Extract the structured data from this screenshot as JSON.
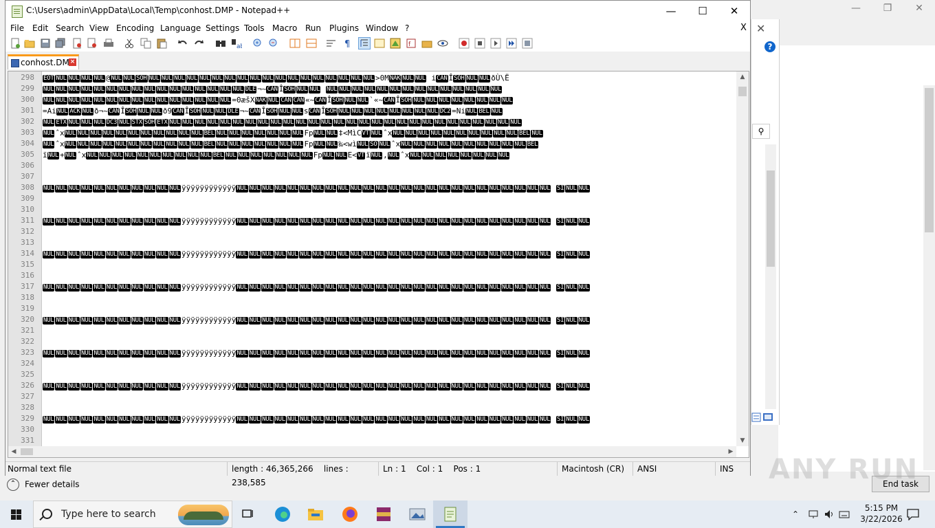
{
  "notepad": {
    "title": "C:\\Users\\admin\\AppData\\Local\\Temp\\conhost.DMP - Notepad++",
    "menu": [
      "File",
      "Edit",
      "Search",
      "View",
      "Encoding",
      "Language",
      "Settings",
      "Tools",
      "Macro",
      "Run",
      "Plugins",
      "Window",
      "?"
    ],
    "menu_close": "X",
    "tab_label": "conhost.DMP",
    "tab_close": "×",
    "status": {
      "file_type": "Normal text file",
      "length": "length : 46,365,266",
      "lines": "lines : 238,585",
      "ln": "Ln : 1",
      "col": "Col : 1",
      "pos": "Pos : 1",
      "eol": "Macintosh (CR)",
      "encoding": "ANSI",
      "mode": "INS"
    },
    "line_numbers": [
      "298",
      "299",
      "300",
      "301",
      "302",
      "303",
      "304",
      "305",
      "306",
      "307",
      "308",
      "309",
      "310",
      "311",
      "312",
      "313",
      "314",
      "315",
      "316",
      "317",
      "318",
      "319",
      "320",
      "321",
      "322",
      "323",
      "324",
      "325",
      "326",
      "327",
      "328",
      "329",
      "330",
      "331"
    ]
  },
  "editor_lines": {
    "298": [
      [
        "c",
        "EOT"
      ],
      [
        "c",
        "NUL"
      ],
      [
        "c",
        "NUL"
      ],
      [
        "c",
        "NUL"
      ],
      [
        "c",
        "NUL"
      ],
      [
        "t",
        "@"
      ],
      [
        "c",
        "NUL"
      ],
      [
        "c",
        "NUL"
      ],
      [
        "c",
        "SOH"
      ],
      [
        "c",
        "NUL"
      ],
      [
        "c",
        "NUL"
      ],
      [
        "c",
        "NUL"
      ],
      [
        "c",
        "NUL"
      ],
      [
        "c",
        "NUL"
      ],
      [
        "c",
        "NUL"
      ],
      [
        "c",
        "NUL"
      ],
      [
        "c",
        "NUL"
      ],
      [
        "c",
        "NUL"
      ],
      [
        "c",
        "NUL"
      ],
      [
        "c",
        "NUL"
      ],
      [
        "c",
        "NUL"
      ],
      [
        "c",
        "NUL"
      ],
      [
        "c",
        "NUL"
      ],
      [
        "c",
        "NUL"
      ],
      [
        "c",
        "NUL"
      ],
      [
        "c",
        "NUL"
      ],
      [
        "c",
        "NUL"
      ],
      [
        "t",
        ">0M"
      ],
      [
        "c",
        "NAK"
      ],
      [
        "c",
        "NUL"
      ],
      [
        "c",
        "NUL"
      ],
      [
        "t",
        " i"
      ],
      [
        "c",
        "CAN"
      ],
      [
        "t",
        "Î"
      ],
      [
        "c",
        "SOH"
      ],
      [
        "c",
        "NUL"
      ],
      [
        "c",
        "NUL"
      ],
      [
        "t",
        "ðÙ\\Ë"
      ]
    ],
    "299": [
      [
        "c",
        "NUL"
      ],
      [
        "c",
        "NUL"
      ],
      [
        "c",
        "NUL"
      ],
      [
        "c",
        "NUL"
      ],
      [
        "c",
        "NUL"
      ],
      [
        "c",
        "NUL"
      ],
      [
        "c",
        "NUL"
      ],
      [
        "c",
        "NUL"
      ],
      [
        "c",
        "NUL"
      ],
      [
        "c",
        "NUL"
      ],
      [
        "c",
        "NUL"
      ],
      [
        "c",
        "NUL"
      ],
      [
        "c",
        "NUL"
      ],
      [
        "c",
        "NUL"
      ],
      [
        "c",
        "NUL"
      ],
      [
        "c",
        "NUL"
      ],
      [
        "c",
        "DLE"
      ],
      [
        "t",
        "¬~"
      ],
      [
        "c",
        "CAN"
      ],
      [
        "t",
        "Î"
      ],
      [
        "c",
        "SOH"
      ],
      [
        "c",
        "NUL"
      ],
      [
        "c",
        "NUL"
      ],
      [
        "t",
        " "
      ],
      [
        "c",
        "NUL"
      ],
      [
        "c",
        "NUL"
      ],
      [
        "c",
        "NUL"
      ],
      [
        "c",
        "NUL"
      ],
      [
        "c",
        "NUL"
      ],
      [
        "c",
        "NUL"
      ],
      [
        "c",
        "NUL"
      ],
      [
        "c",
        "NUL"
      ],
      [
        "c",
        "NUL"
      ],
      [
        "c",
        "NUL"
      ],
      [
        "c",
        "NUL"
      ],
      [
        "c",
        "NUL"
      ],
      [
        "c",
        "NUL"
      ],
      [
        "c",
        "NUL"
      ]
    ],
    "300": [
      [
        "c",
        "NUL"
      ],
      [
        "c",
        "NUL"
      ],
      [
        "c",
        "NUL"
      ],
      [
        "c",
        "NUL"
      ],
      [
        "c",
        "NUL"
      ],
      [
        "c",
        "NUL"
      ],
      [
        "c",
        "NUL"
      ],
      [
        "c",
        "NUL"
      ],
      [
        "c",
        "NUL"
      ],
      [
        "c",
        "NUL"
      ],
      [
        "c",
        "NUL"
      ],
      [
        "c",
        "NUL"
      ],
      [
        "c",
        "NUL"
      ],
      [
        "c",
        "NUL"
      ],
      [
        "c",
        "NUL"
      ],
      [
        "t",
        "=0æšX"
      ],
      [
        "c",
        "NAK"
      ],
      [
        "c",
        "NUL"
      ],
      [
        "c",
        "CAN"
      ],
      [
        "c",
        "CAN"
      ],
      [
        "t",
        "«~"
      ],
      [
        "c",
        "CAN"
      ],
      [
        "t",
        "Î"
      ],
      [
        "c",
        "SOH"
      ],
      [
        "c",
        "NUL"
      ],
      [
        "c",
        "NUL"
      ],
      [
        "t",
        "`«~"
      ],
      [
        "c",
        "CAN"
      ],
      [
        "t",
        "Î"
      ],
      [
        "c",
        "SOH"
      ],
      [
        "c",
        "NUL"
      ],
      [
        "c",
        "NUL"
      ],
      [
        "c",
        "NUL"
      ],
      [
        "c",
        "NUL"
      ],
      [
        "c",
        "NUL"
      ],
      [
        "c",
        "NUL"
      ],
      [
        "c",
        "NUL"
      ],
      [
        "c",
        "NUL"
      ]
    ],
    "301": [
      [
        "t",
        "=Ai"
      ],
      [
        "c",
        "NUL"
      ],
      [
        "c",
        "ACK"
      ],
      [
        "c",
        "NUL"
      ],
      [
        "t",
        "ð¬~"
      ],
      [
        "c",
        "CAN"
      ],
      [
        "t",
        "Î"
      ],
      [
        "c",
        "SOH"
      ],
      [
        "c",
        "NUL"
      ],
      [
        "c",
        "NUL"
      ],
      [
        "t",
        "ð9"
      ],
      [
        "c",
        "CAN"
      ],
      [
        "t",
        "Î"
      ],
      [
        "c",
        "SOH"
      ],
      [
        "c",
        "NUL"
      ],
      [
        "c",
        "NUL"
      ],
      [
        "c",
        "DLE"
      ],
      [
        "t",
        "¬~"
      ],
      [
        "c",
        "CAN"
      ],
      [
        "t",
        "Î"
      ],
      [
        "c",
        "SOH"
      ],
      [
        "c",
        "NUL"
      ],
      [
        "c",
        "NUL"
      ],
      [
        "t",
        "s"
      ],
      [
        "c",
        "CAN"
      ],
      [
        "t",
        "Î"
      ],
      [
        "c",
        "SOH"
      ],
      [
        "c",
        "NUL"
      ],
      [
        "c",
        "NUL"
      ],
      [
        "c",
        "NUL"
      ],
      [
        "c",
        "NUL"
      ],
      [
        "c",
        "NUL"
      ],
      [
        "c",
        "NUL"
      ],
      [
        "c",
        "NUL"
      ],
      [
        "c",
        "NUL"
      ],
      [
        "c",
        "DC2"
      ],
      [
        "t",
        "=Ni"
      ],
      [
        "c",
        "NUL"
      ],
      [
        "c",
        "BEL"
      ],
      [
        "c",
        "NUL"
      ]
    ],
    "302": [
      [
        "c",
        "NUL"
      ],
      [
        "c",
        "ETX"
      ],
      [
        "c",
        "NUL"
      ],
      [
        "c",
        "NUL"
      ],
      [
        "c",
        "NUL"
      ],
      [
        "c",
        "DC3"
      ],
      [
        "c",
        "NUL"
      ],
      [
        "c",
        "STX"
      ],
      [
        "c",
        "SOH"
      ],
      [
        "c",
        "ETX"
      ],
      [
        "c",
        "NUL"
      ],
      [
        "c",
        "NUL"
      ],
      [
        "c",
        "NUL"
      ],
      [
        "c",
        "NUL"
      ],
      [
        "c",
        "NUL"
      ],
      [
        "c",
        "NUL"
      ],
      [
        "c",
        "NUL"
      ],
      [
        "c",
        "NUL"
      ],
      [
        "c",
        "NUL"
      ],
      [
        "c",
        "NUL"
      ],
      [
        "c",
        "NUL"
      ],
      [
        "c",
        "NUL"
      ],
      [
        "c",
        "NUL"
      ],
      [
        "c",
        "NUL"
      ],
      [
        "c",
        "NUL"
      ],
      [
        "c",
        "NUL"
      ],
      [
        "c",
        "NUL"
      ],
      [
        "c",
        "NUL"
      ],
      [
        "c",
        "NUL"
      ],
      [
        "c",
        "NUL"
      ],
      [
        "c",
        "NUL"
      ],
      [
        "c",
        "NUL"
      ],
      [
        "c",
        "NUL"
      ],
      [
        "c",
        "NUL"
      ],
      [
        "c",
        "NUL"
      ],
      [
        "c",
        "NUL"
      ],
      [
        "c",
        "NUL"
      ],
      [
        "c",
        "NUL"
      ]
    ],
    "303": [
      [
        "c",
        "NUL"
      ],
      [
        "t",
        "ˆx"
      ],
      [
        "c",
        "NUL"
      ],
      [
        "c",
        "NUL"
      ],
      [
        "c",
        "NUL"
      ],
      [
        "c",
        "NUL"
      ],
      [
        "c",
        "NUL"
      ],
      [
        "c",
        "NUL"
      ],
      [
        "c",
        "NUL"
      ],
      [
        "c",
        "NUL"
      ],
      [
        "c",
        "NUL"
      ],
      [
        "c",
        "NUL"
      ],
      [
        "c",
        "NUL"
      ],
      [
        "c",
        "BEL"
      ],
      [
        "c",
        "NUL"
      ],
      [
        "c",
        "NUL"
      ],
      [
        "c",
        "NUL"
      ],
      [
        "c",
        "NUL"
      ],
      [
        "c",
        "NUL"
      ],
      [
        "c",
        "NUL"
      ],
      [
        "c",
        "NUL"
      ],
      [
        "t",
        "Fp"
      ],
      [
        "c",
        "NUL"
      ],
      [
        "c",
        "NUL"
      ],
      [
        "t",
        "‡<MìC"
      ],
      [
        "c",
        "VT"
      ],
      [
        "c",
        "NUL"
      ],
      [
        "t",
        "ˆx"
      ],
      [
        "c",
        "NUL"
      ],
      [
        "c",
        "NUL"
      ],
      [
        "c",
        "NUL"
      ],
      [
        "c",
        "NUL"
      ],
      [
        "c",
        "NUL"
      ],
      [
        "c",
        "NUL"
      ],
      [
        "c",
        "NUL"
      ],
      [
        "c",
        "NUL"
      ],
      [
        "c",
        "NUL"
      ],
      [
        "c",
        "NUL"
      ],
      [
        "c",
        "BEL"
      ],
      [
        "c",
        "NUL"
      ]
    ],
    "304": [
      [
        "c",
        "NUL"
      ],
      [
        "t",
        "ˆx"
      ],
      [
        "c",
        "NUL"
      ],
      [
        "c",
        "NUL"
      ],
      [
        "c",
        "NUL"
      ],
      [
        "c",
        "NUL"
      ],
      [
        "c",
        "NUL"
      ],
      [
        "c",
        "NUL"
      ],
      [
        "c",
        "NUL"
      ],
      [
        "c",
        "NUL"
      ],
      [
        "c",
        "NUL"
      ],
      [
        "c",
        "NUL"
      ],
      [
        "c",
        "NUL"
      ],
      [
        "c",
        "BEL"
      ],
      [
        "c",
        "NUL"
      ],
      [
        "c",
        "NUL"
      ],
      [
        "c",
        "NUL"
      ],
      [
        "c",
        "NUL"
      ],
      [
        "c",
        "NUL"
      ],
      [
        "c",
        "NUL"
      ],
      [
        "c",
        "NUL"
      ],
      [
        "t",
        "Fp"
      ],
      [
        "c",
        "NUL"
      ],
      [
        "c",
        "NUL"
      ],
      [
        "t",
        "‰<wì"
      ],
      [
        "c",
        "NUL"
      ],
      [
        "c",
        "SO"
      ],
      [
        "c",
        "NUL"
      ],
      [
        "t",
        "ˆx"
      ],
      [
        "c",
        "NUL"
      ],
      [
        "c",
        "NUL"
      ],
      [
        "c",
        "NUL"
      ],
      [
        "c",
        "NUL"
      ],
      [
        "c",
        "NUL"
      ],
      [
        "c",
        "NUL"
      ],
      [
        "c",
        "NUL"
      ],
      [
        "c",
        "NUL"
      ],
      [
        "c",
        "NUL"
      ],
      [
        "c",
        "NUL"
      ],
      [
        "c",
        "BEL"
      ]
    ],
    "305": [
      [
        "t",
        "ï"
      ],
      [
        "c",
        "NUL"
      ],
      [
        "t",
        "+"
      ],
      [
        "c",
        "NUL"
      ],
      [
        "t",
        "ˆx"
      ],
      [
        "c",
        "NUL"
      ],
      [
        "c",
        "NUL"
      ],
      [
        "c",
        "NUL"
      ],
      [
        "c",
        "NUL"
      ],
      [
        "c",
        "NUL"
      ],
      [
        "c",
        "NUL"
      ],
      [
        "c",
        "NUL"
      ],
      [
        "c",
        "NUL"
      ],
      [
        "c",
        "NUL"
      ],
      [
        "c",
        "NUL"
      ],
      [
        "c",
        "BEL"
      ],
      [
        "c",
        "NUL"
      ],
      [
        "c",
        "NUL"
      ],
      [
        "c",
        "NUL"
      ],
      [
        "c",
        "NUL"
      ],
      [
        "c",
        "NUL"
      ],
      [
        "c",
        "NUL"
      ],
      [
        "c",
        "NUL"
      ],
      [
        "t",
        "Fp"
      ],
      [
        "c",
        "NUL"
      ],
      [
        "c",
        "NUL"
      ],
      [
        "t",
        "E<"
      ],
      [
        "c",
        "VT"
      ],
      [
        "t",
        "ï"
      ],
      [
        "c",
        "NUL"
      ],
      [
        "t",
        ","
      ],
      [
        "c",
        "NUL"
      ],
      [
        "t",
        "ˆx"
      ],
      [
        "c",
        "NUL"
      ],
      [
        "c",
        "NUL"
      ],
      [
        "c",
        "NUL"
      ],
      [
        "c",
        "NUL"
      ],
      [
        "c",
        "NUL"
      ],
      [
        "c",
        "NUL"
      ],
      [
        "c",
        "NUL"
      ],
      [
        "c",
        "NUL"
      ]
    ],
    "pattern": [
      [
        "c",
        "NUL"
      ],
      [
        "c",
        "NUL"
      ],
      [
        "c",
        "NUL"
      ],
      [
        "c",
        "NUL"
      ],
      [
        "c",
        "NUL"
      ],
      [
        "c",
        "NUL"
      ],
      [
        "c",
        "NUL"
      ],
      [
        "c",
        "NUL"
      ],
      [
        "c",
        "NUL"
      ],
      [
        "c",
        "NUL"
      ],
      [
        "c",
        "NUL"
      ],
      [
        "t",
        "ÿÿÿÿÿÿÿÿÿÿÿÿ"
      ],
      [
        "c",
        "NUL"
      ],
      [
        "c",
        "NUL"
      ],
      [
        "c",
        "NUL"
      ],
      [
        "c",
        "NUL"
      ],
      [
        "c",
        "NUL"
      ],
      [
        "c",
        "NUL"
      ],
      [
        "c",
        "NUL"
      ],
      [
        "c",
        "NUL"
      ],
      [
        "c",
        "NUL"
      ],
      [
        "c",
        "NUL"
      ],
      [
        "c",
        "NUL"
      ],
      [
        "c",
        "NUL"
      ],
      [
        "c",
        "NUL"
      ],
      [
        "c",
        "NUL"
      ],
      [
        "c",
        "NUL"
      ],
      [
        "c",
        "NUL"
      ],
      [
        "c",
        "NUL"
      ],
      [
        "c",
        "NUL"
      ],
      [
        "c",
        "NUL"
      ],
      [
        "c",
        "NUL"
      ],
      [
        "c",
        "NUL"
      ],
      [
        "c",
        "NUL"
      ],
      [
        "c",
        "NUL"
      ],
      [
        "c",
        "NUL"
      ],
      [
        "c",
        "NUL"
      ],
      [
        "t",
        " "
      ],
      [
        "c",
        "SI"
      ],
      [
        "c",
        "NUL"
      ],
      [
        "c",
        "NUL"
      ]
    ]
  },
  "background": {
    "fewer_details": "Fewer details",
    "end_task": "End task",
    "watermark": "ANY RUN",
    "help": "?"
  },
  "taskbar": {
    "search_placeholder": "Type here to search",
    "time": "5:15 PM",
    "date": "3/22/2026"
  },
  "colors": {
    "tab_accent": "#fa9a1a",
    "control_char_bg": "#000000",
    "taskbar_bg": "#e6ecf3"
  }
}
